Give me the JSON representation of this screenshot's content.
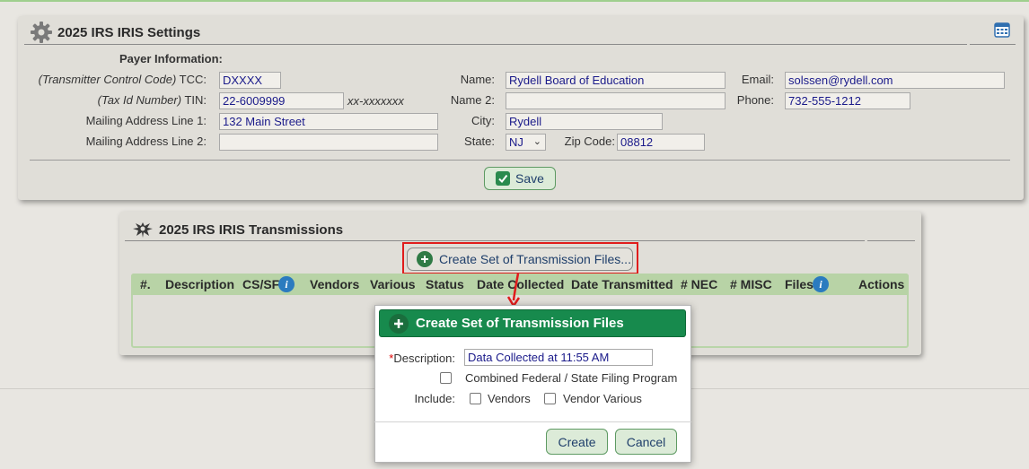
{
  "settings": {
    "title": "2025 IRS IRIS Settings",
    "payer_info_label": "Payer Information:",
    "tcc_label_italic": "(Transmitter Control Code)",
    "tcc_label": " TCC:",
    "tcc_value": "DXXXX",
    "tin_label_italic": "(Tax Id Number)",
    "tin_label": " TIN:",
    "tin_value": "22-6009999",
    "tin_hint": "xx-xxxxxxx",
    "addr1_label": "Mailing Address Line 1:",
    "addr1_value": "132 Main Street",
    "addr2_label": "Mailing Address Line 2:",
    "addr2_value": "",
    "name_label": "Name:",
    "name_value": "Rydell Board of Education",
    "name2_label": "Name 2:",
    "name2_value": "",
    "city_label": "City:",
    "city_value": "Rydell",
    "state_label": "State:",
    "state_value": "NJ",
    "zip_label": "Zip Code:",
    "zip_value": "08812",
    "email_label": "Email:",
    "email_value": "solssen@rydell.com",
    "phone_label": "Phone:",
    "phone_value": "732-555-1212",
    "save_label": "Save"
  },
  "transmissions": {
    "title": "2025 IRS IRIS Transmissions",
    "create_button_label": "Create Set of Transmission Files...",
    "columns": [
      "#.",
      "Description",
      "CS/SF",
      "Vendors",
      "Various",
      "Status",
      "Date Collected",
      "Date Transmitted",
      "# NEC",
      "# MISC",
      "Files",
      "Actions"
    ]
  },
  "modal": {
    "title": "Create Set of Transmission Files",
    "required_mark": "*",
    "description_label": "Description:",
    "description_value": "Data Collected at 11:55 AM",
    "combined_label": "Combined Federal / State Filing Program",
    "include_label": "Include:",
    "vendors_label": "Vendors",
    "vendor_various_label": "Vendor Various",
    "create_label": "Create",
    "cancel_label": "Cancel"
  },
  "colors": {
    "accent_green": "#178a4d",
    "highlight_red": "#e01c1c",
    "header_green": "#b8d3a6"
  }
}
